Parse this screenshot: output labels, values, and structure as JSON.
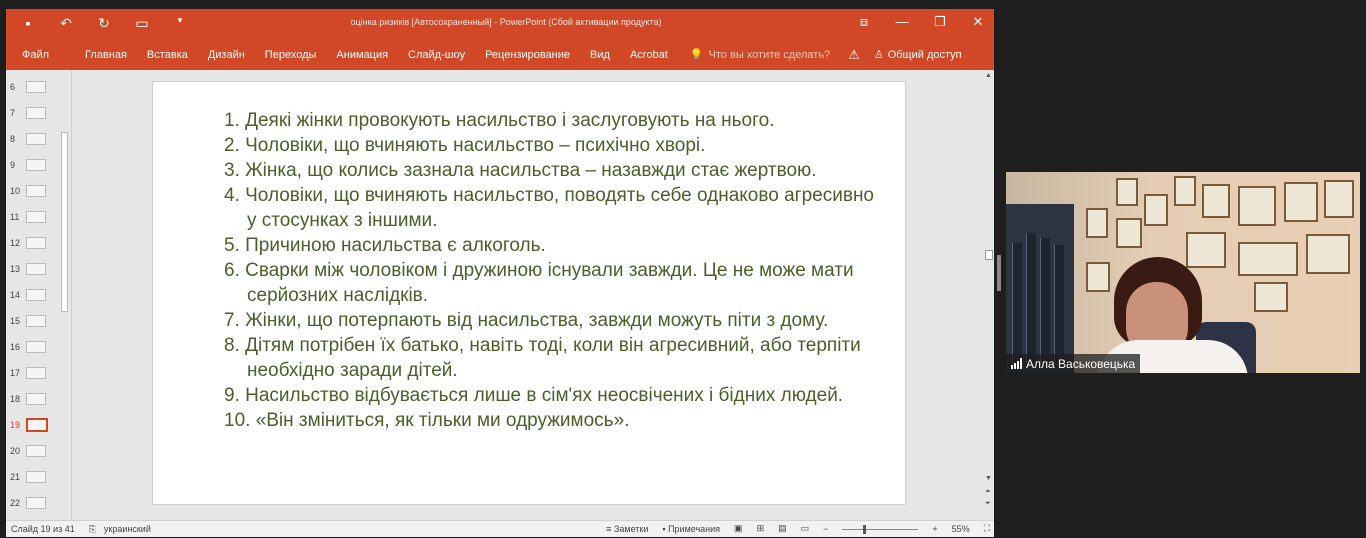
{
  "window": {
    "title": "оцінка ризиків [Автосохраненный] - PowerPoint (Сбой активации продукта)"
  },
  "ribbon": {
    "tabs": [
      "Файл",
      "Главная",
      "Вставка",
      "Дизайн",
      "Переходы",
      "Анимация",
      "Слайд-шоу",
      "Рецензирование",
      "Вид",
      "Acrobat"
    ],
    "tellme": "Что вы хотите сделать?",
    "share": "Общий доступ"
  },
  "thumbnails": [
    {
      "num": "6",
      "active": false
    },
    {
      "num": "7",
      "active": false
    },
    {
      "num": "8",
      "active": false
    },
    {
      "num": "9",
      "active": false
    },
    {
      "num": "10",
      "active": false
    },
    {
      "num": "11",
      "active": false
    },
    {
      "num": "12",
      "active": false
    },
    {
      "num": "13",
      "active": false
    },
    {
      "num": "14",
      "active": false
    },
    {
      "num": "15",
      "active": false
    },
    {
      "num": "16",
      "active": false
    },
    {
      "num": "17",
      "active": false
    },
    {
      "num": "18",
      "active": false
    },
    {
      "num": "19",
      "active": true
    },
    {
      "num": "20",
      "active": false
    },
    {
      "num": "21",
      "active": false
    },
    {
      "num": "22",
      "active": false
    }
  ],
  "slide": {
    "items": [
      "1.  Деякі жінки провокують насильство і заслуговують на нього.",
      "2. Чоловіки, що вчиняють насильство – психічно хворі.",
      "3. Жінка, що колись зазнала насильства – назавжди стає жертвою.",
      "4. Чоловіки, що вчиняють насильство, поводять себе однаково агресивно у стосунках з іншими.",
      "5. Причиною насильства є алкоголь.",
      "6. Сварки між чоловіком і дружиною існували завжди. Це не може мати серйозних наслідків.",
      "7. Жінки, що потерпають від насильства, завжди можуть піти з дому.",
      "8. Дітям потрібен їх батько, навіть тоді, коли він агресивний, або терпіти необхідно заради дітей.",
      "9. Насильство відбувається лише в сім'ях неосвічених і бідних людей.",
      "10. «Він зміниться, як тільки ми одружимось»."
    ]
  },
  "status": {
    "slide_counter": "Слайд 19 из 41",
    "language": "украинский",
    "notes": "Заметки",
    "comments": "Примечания",
    "zoom": "55%",
    "zoom_fraction": 0.55
  },
  "video": {
    "participant": "Алла Васьковецька"
  },
  "colors": {
    "accent": "#d24726",
    "slide_text": "#4a5f2a"
  }
}
